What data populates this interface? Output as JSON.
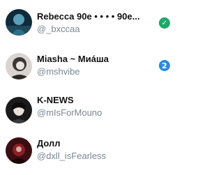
{
  "accounts": [
    {
      "name": "Rebecca 90e • • • • 90e...",
      "handle": "@_bxccaa",
      "badge": {
        "type": "verified",
        "icon": "check-icon",
        "glyph": "✓",
        "color": "#1da86a"
      }
    },
    {
      "name": "Miasha ~ Миáша",
      "handle": "@mshvibe",
      "badge": {
        "type": "count",
        "value": "2",
        "color": "#2a8ce0"
      }
    },
    {
      "name": "K-NEWS",
      "handle": "@mIsForMouno"
    },
    {
      "name": "Долл",
      "handle": "@dxll_isFearless"
    }
  ]
}
